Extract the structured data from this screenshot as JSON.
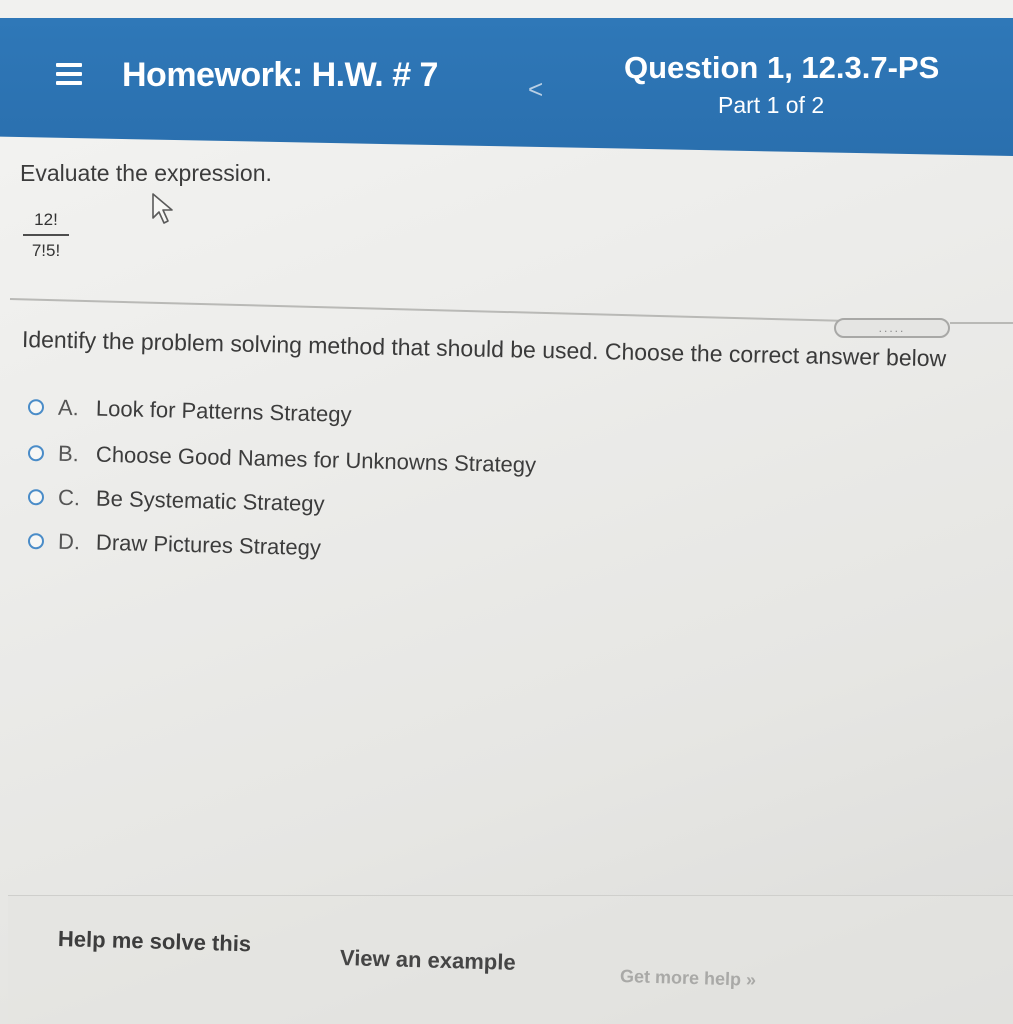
{
  "header": {
    "homework_title": "Homework: H.W. # 7",
    "back_glyph": "<",
    "question_title": "Question 1, 12.3.7-PS",
    "question_part": "Part 1 of 2"
  },
  "problem": {
    "prompt": "Evaluate the expression.",
    "fraction_numerator": "12!",
    "fraction_denominator": "7!5!",
    "more_indicator": "....."
  },
  "question": {
    "instruction": "Identify the problem solving method that should be used. Choose the correct answer below",
    "options": [
      {
        "letter": "A.",
        "label": "Look for Patterns Strategy"
      },
      {
        "letter": "B.",
        "label": "Choose Good Names for Unknowns Strategy"
      },
      {
        "letter": "C.",
        "label": "Be Systematic Strategy"
      },
      {
        "letter": "D.",
        "label": "Draw Pictures Strategy"
      }
    ]
  },
  "help": {
    "solve_label": "Help me solve this",
    "example_label": "View an example",
    "more_label": "Get more help »"
  },
  "icons": {
    "menu": "menu-icon",
    "cursor": "mouse-cursor-icon",
    "radio": "radio-button"
  },
  "colors": {
    "header_blue": "#2f78b8",
    "radio_blue": "#4a8cc8"
  }
}
